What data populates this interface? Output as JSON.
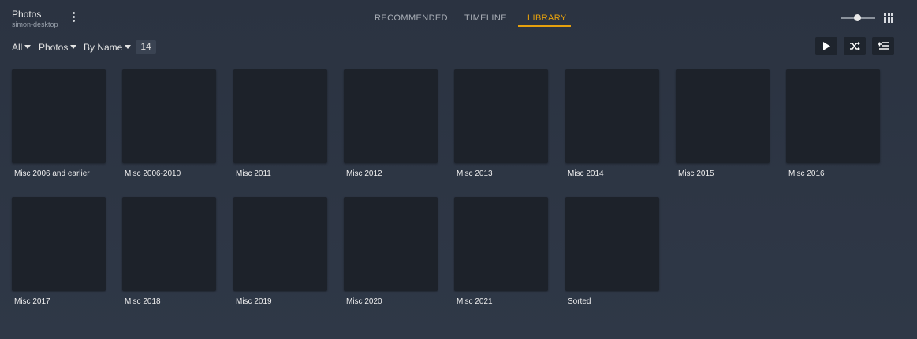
{
  "header": {
    "library_title": "Photos",
    "server_name": "simon-desktop"
  },
  "tabs": [
    {
      "label": "RECOMMENDED",
      "active": false
    },
    {
      "label": "TIMELINE",
      "active": false
    },
    {
      "label": "LIBRARY",
      "active": true
    }
  ],
  "accent_color": "#e5a00d",
  "toolbar": {
    "filter_all": "All",
    "filter_type": "Photos",
    "sort": "By Name",
    "item_count": "14",
    "play_icon": "play-icon",
    "shuffle_icon": "shuffle-icon",
    "queue_icon": "add-to-queue-icon"
  },
  "items": [
    {
      "title": "Misc 2006 and earlier"
    },
    {
      "title": "Misc 2006-2010"
    },
    {
      "title": "Misc 2011"
    },
    {
      "title": "Misc 2012"
    },
    {
      "title": "Misc 2013"
    },
    {
      "title": "Misc 2014"
    },
    {
      "title": "Misc 2015"
    },
    {
      "title": "Misc 2016"
    },
    {
      "title": "Misc 2017"
    },
    {
      "title": "Misc 2018"
    },
    {
      "title": "Misc 2019"
    },
    {
      "title": "Misc 2020"
    },
    {
      "title": "Misc 2021"
    },
    {
      "title": "Sorted"
    }
  ]
}
